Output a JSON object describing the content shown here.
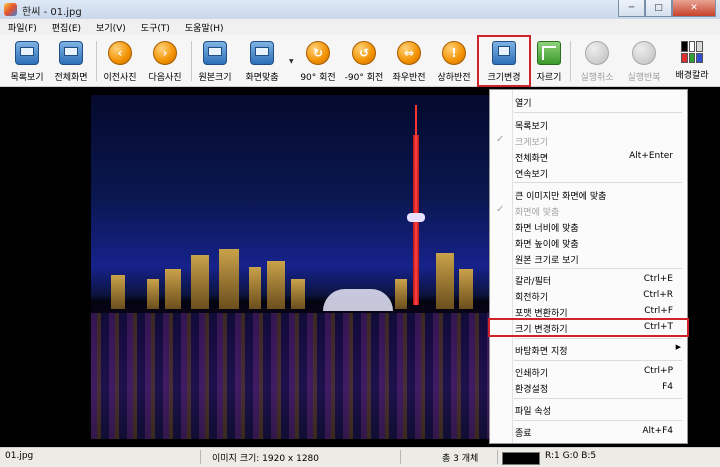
{
  "window": {
    "title": "한씨 - 01.jpg",
    "controls": [
      "─",
      "□",
      "✕"
    ]
  },
  "menubar": [
    "파일(F)",
    "편집(E)",
    "보기(V)",
    "도구(T)",
    "도움말(H)"
  ],
  "toolbar": {
    "browse": "목록보기",
    "fullscreen": "전체화면",
    "prev": "이전사진",
    "next": "다음사진",
    "original_size": "원본크기",
    "fit_screen": "화면맞춤",
    "rotate_cw": "90° 회전",
    "rotate_ccw": "-90° 회전",
    "flip_h": "좌우반전",
    "flip_v": "상하반전",
    "resize": "크기변경",
    "crop": "자르기",
    "undo": "실행취소",
    "redo": "실행반복",
    "bg_color": "배경칼라"
  },
  "context_menu": {
    "open": "열기",
    "browse": "목록보기",
    "large_view": "크게보기",
    "fullscreen": {
      "label": "전체화면",
      "shortcut": "Alt+Enter"
    },
    "slideshow": "연속보기",
    "fit_large": "큰 이미지만 화면에 맞춤",
    "fit_screen": "화면에 맞춤",
    "fit_width": "화면 너비에 맞춤",
    "fit_height": "화면 높이에 맞춤",
    "original": "원본 크기로 보기",
    "color_filter": {
      "label": "칼라/필터",
      "shortcut": "Ctrl+E"
    },
    "rotate": {
      "label": "회전하기",
      "shortcut": "Ctrl+R"
    },
    "convert_format": {
      "label": "포맷 변환하기",
      "shortcut": "Ctrl+F"
    },
    "resize": {
      "label": "크기 변경하기",
      "shortcut": "Ctrl+T"
    },
    "set_wallpaper": "바탕화면 지정",
    "print": {
      "label": "인쇄하기",
      "shortcut": "Ctrl+P"
    },
    "settings": {
      "label": "환경설정",
      "shortcut": "F4"
    },
    "file_properties": "파일 속성",
    "exit": {
      "label": "종료",
      "shortcut": "Alt+F4"
    }
  },
  "statusbar": {
    "filename": "01.jpg",
    "image_size": "이미지 크기: 1920 x 1280",
    "count": "총 3 개체",
    "rgb": "R:1 G:0 B:5"
  },
  "colors": {
    "highlight": "#d0242b",
    "bg_colors": [
      "#000000",
      "#ffffff",
      "#d9d9d9",
      "#e03030",
      "#30a030",
      "#3050d0"
    ]
  }
}
